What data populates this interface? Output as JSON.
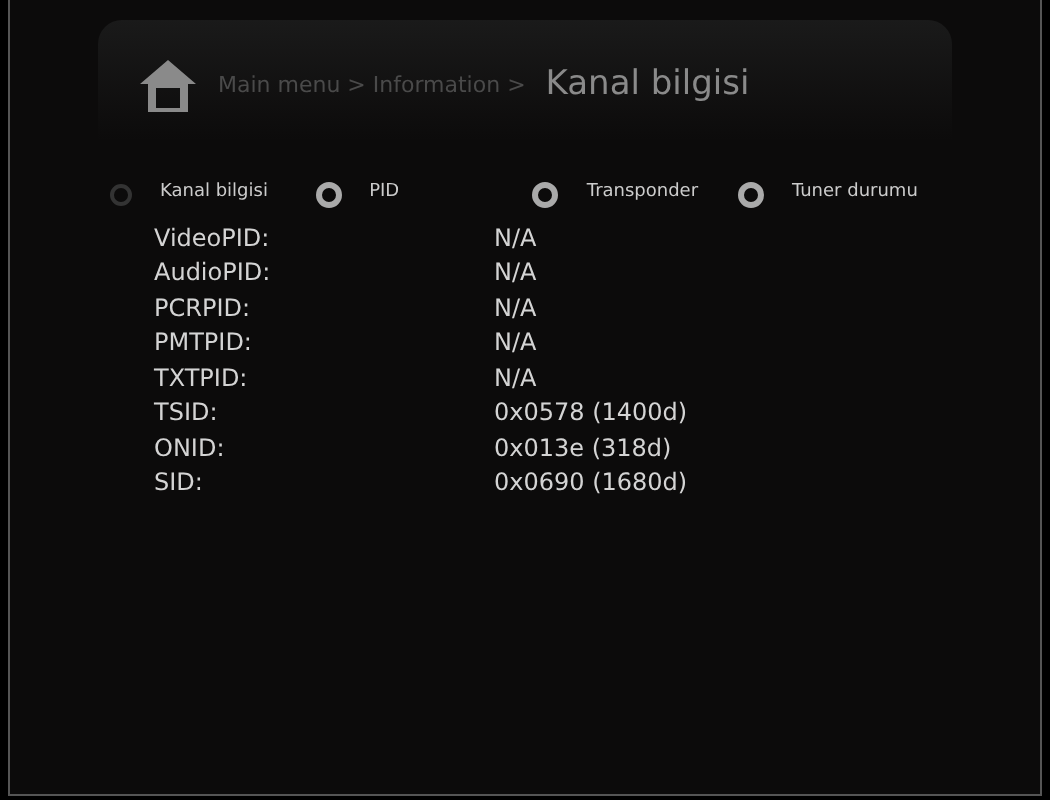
{
  "breadcrumb": {
    "path": "Main menu > Information >",
    "title": "Kanal bilgisi"
  },
  "tabs": [
    {
      "label": "Kanal bilgisi",
      "disabled": true
    },
    {
      "label": "PID",
      "disabled": false
    },
    {
      "label": "Transponder",
      "disabled": false
    },
    {
      "label": "Tuner durumu",
      "disabled": false
    }
  ],
  "rows": [
    {
      "label": "VideoPID:",
      "value": "N/A"
    },
    {
      "label": "AudioPID:",
      "value": "N/A"
    },
    {
      "label": "PCRPID:",
      "value": "N/A"
    },
    {
      "label": "PMTPID:",
      "value": "N/A"
    },
    {
      "label": "TXTPID:",
      "value": "N/A"
    },
    {
      "label": "TSID:",
      "value": "0x0578 (1400d)"
    },
    {
      "label": "ONID:",
      "value": "0x013e (318d)"
    },
    {
      "label": "SID:",
      "value": "0x0690 (1680d)"
    }
  ]
}
